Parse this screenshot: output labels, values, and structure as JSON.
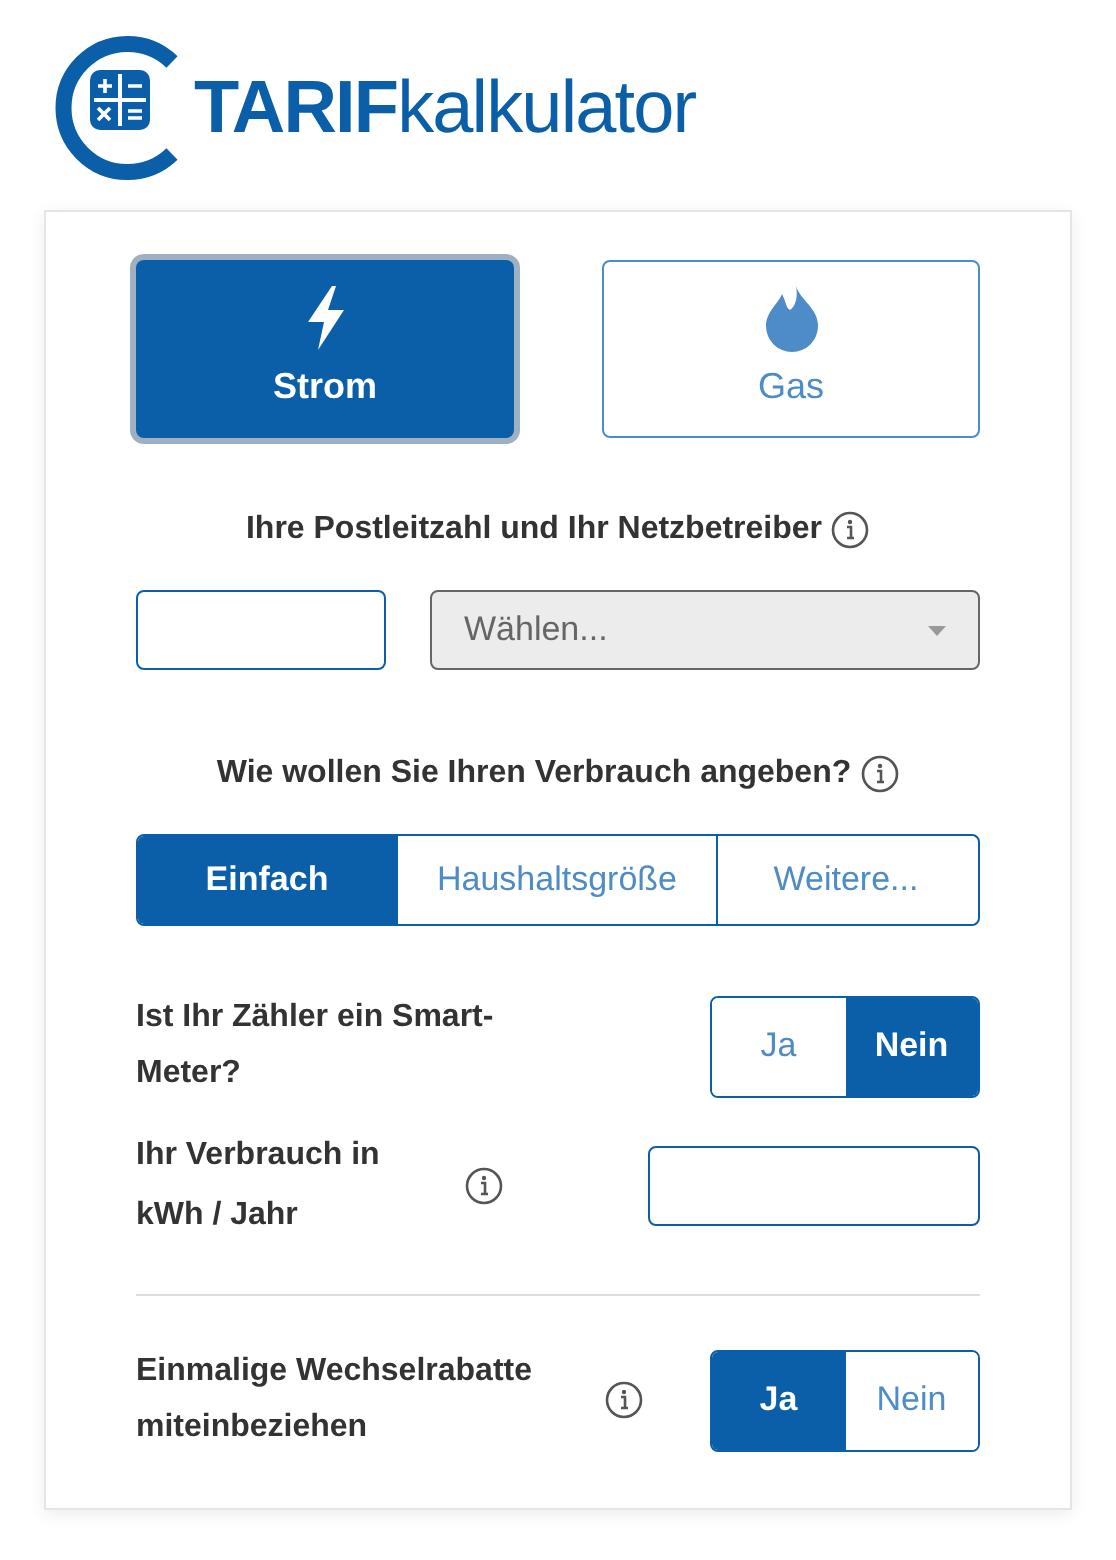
{
  "logo": {
    "bold": "TARIF",
    "light": "kalkulator"
  },
  "energy": [
    {
      "label": "Strom",
      "kind": "bolt",
      "selected": true
    },
    {
      "label": "Gas",
      "kind": "flame",
      "selected": false
    }
  ],
  "location": {
    "label": "Ihre Postleitzahl und Ihr Netzbetreiber",
    "select": "Wählen..."
  },
  "usage_mode": {
    "label": "Wie wollen Sie Ihren Verbrauch angeben?",
    "options": [
      {
        "label": "Einfach",
        "selected": true
      },
      {
        "label": "Haushaltsgröße",
        "selected": false
      },
      {
        "label": "Weitere...",
        "selected": false
      }
    ]
  },
  "rows": [
    {
      "kind": "toggle",
      "label": "Ist Ihr Zähler ein Smart-Meter?",
      "info": false,
      "options": [
        {
          "label": "Ja",
          "selected": false
        },
        {
          "label": "Nein",
          "selected": true
        }
      ]
    },
    {
      "kind": "input",
      "label": "Ihr Verbrauch in kWh / Jahr",
      "info": true
    },
    {
      "kind": "divider"
    },
    {
      "kind": "toggle",
      "label": "Einmalige Wechselrabatte miteinbeziehen",
      "info": true,
      "options": [
        {
          "label": "Ja",
          "selected": true
        },
        {
          "label": "Nein",
          "selected": false
        }
      ]
    }
  ]
}
